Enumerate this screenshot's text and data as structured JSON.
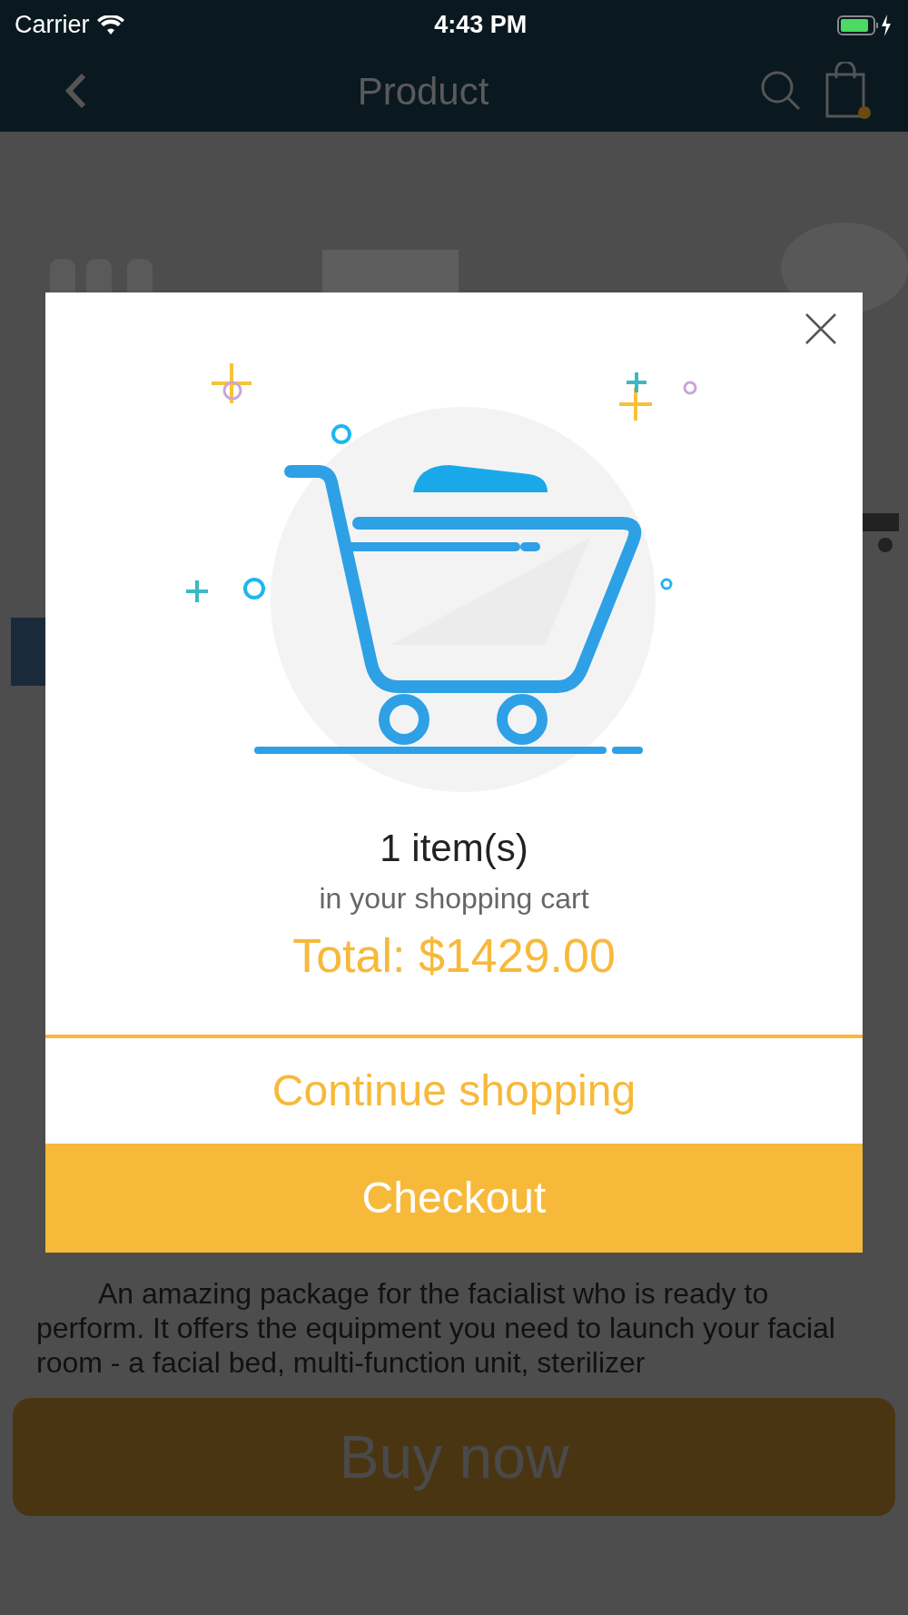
{
  "status_bar": {
    "carrier": "Carrier",
    "time": "4:43 PM"
  },
  "nav": {
    "title": "Product",
    "cart_badge": true
  },
  "description": "An amazing package for the facialist who is ready to perform. It offers the equipment you need to launch your facial room - a facial bed, multi-function unit, sterilizer",
  "buy_button": {
    "label": "Buy now"
  },
  "dialog": {
    "count": "1 item(s)",
    "subtitle": "in your shopping cart",
    "total": "Total: $1429.00",
    "buttons": [
      {
        "label": "Continue shopping",
        "kind": "secondary"
      },
      {
        "label": "Checkout",
        "kind": "primary"
      }
    ]
  }
}
